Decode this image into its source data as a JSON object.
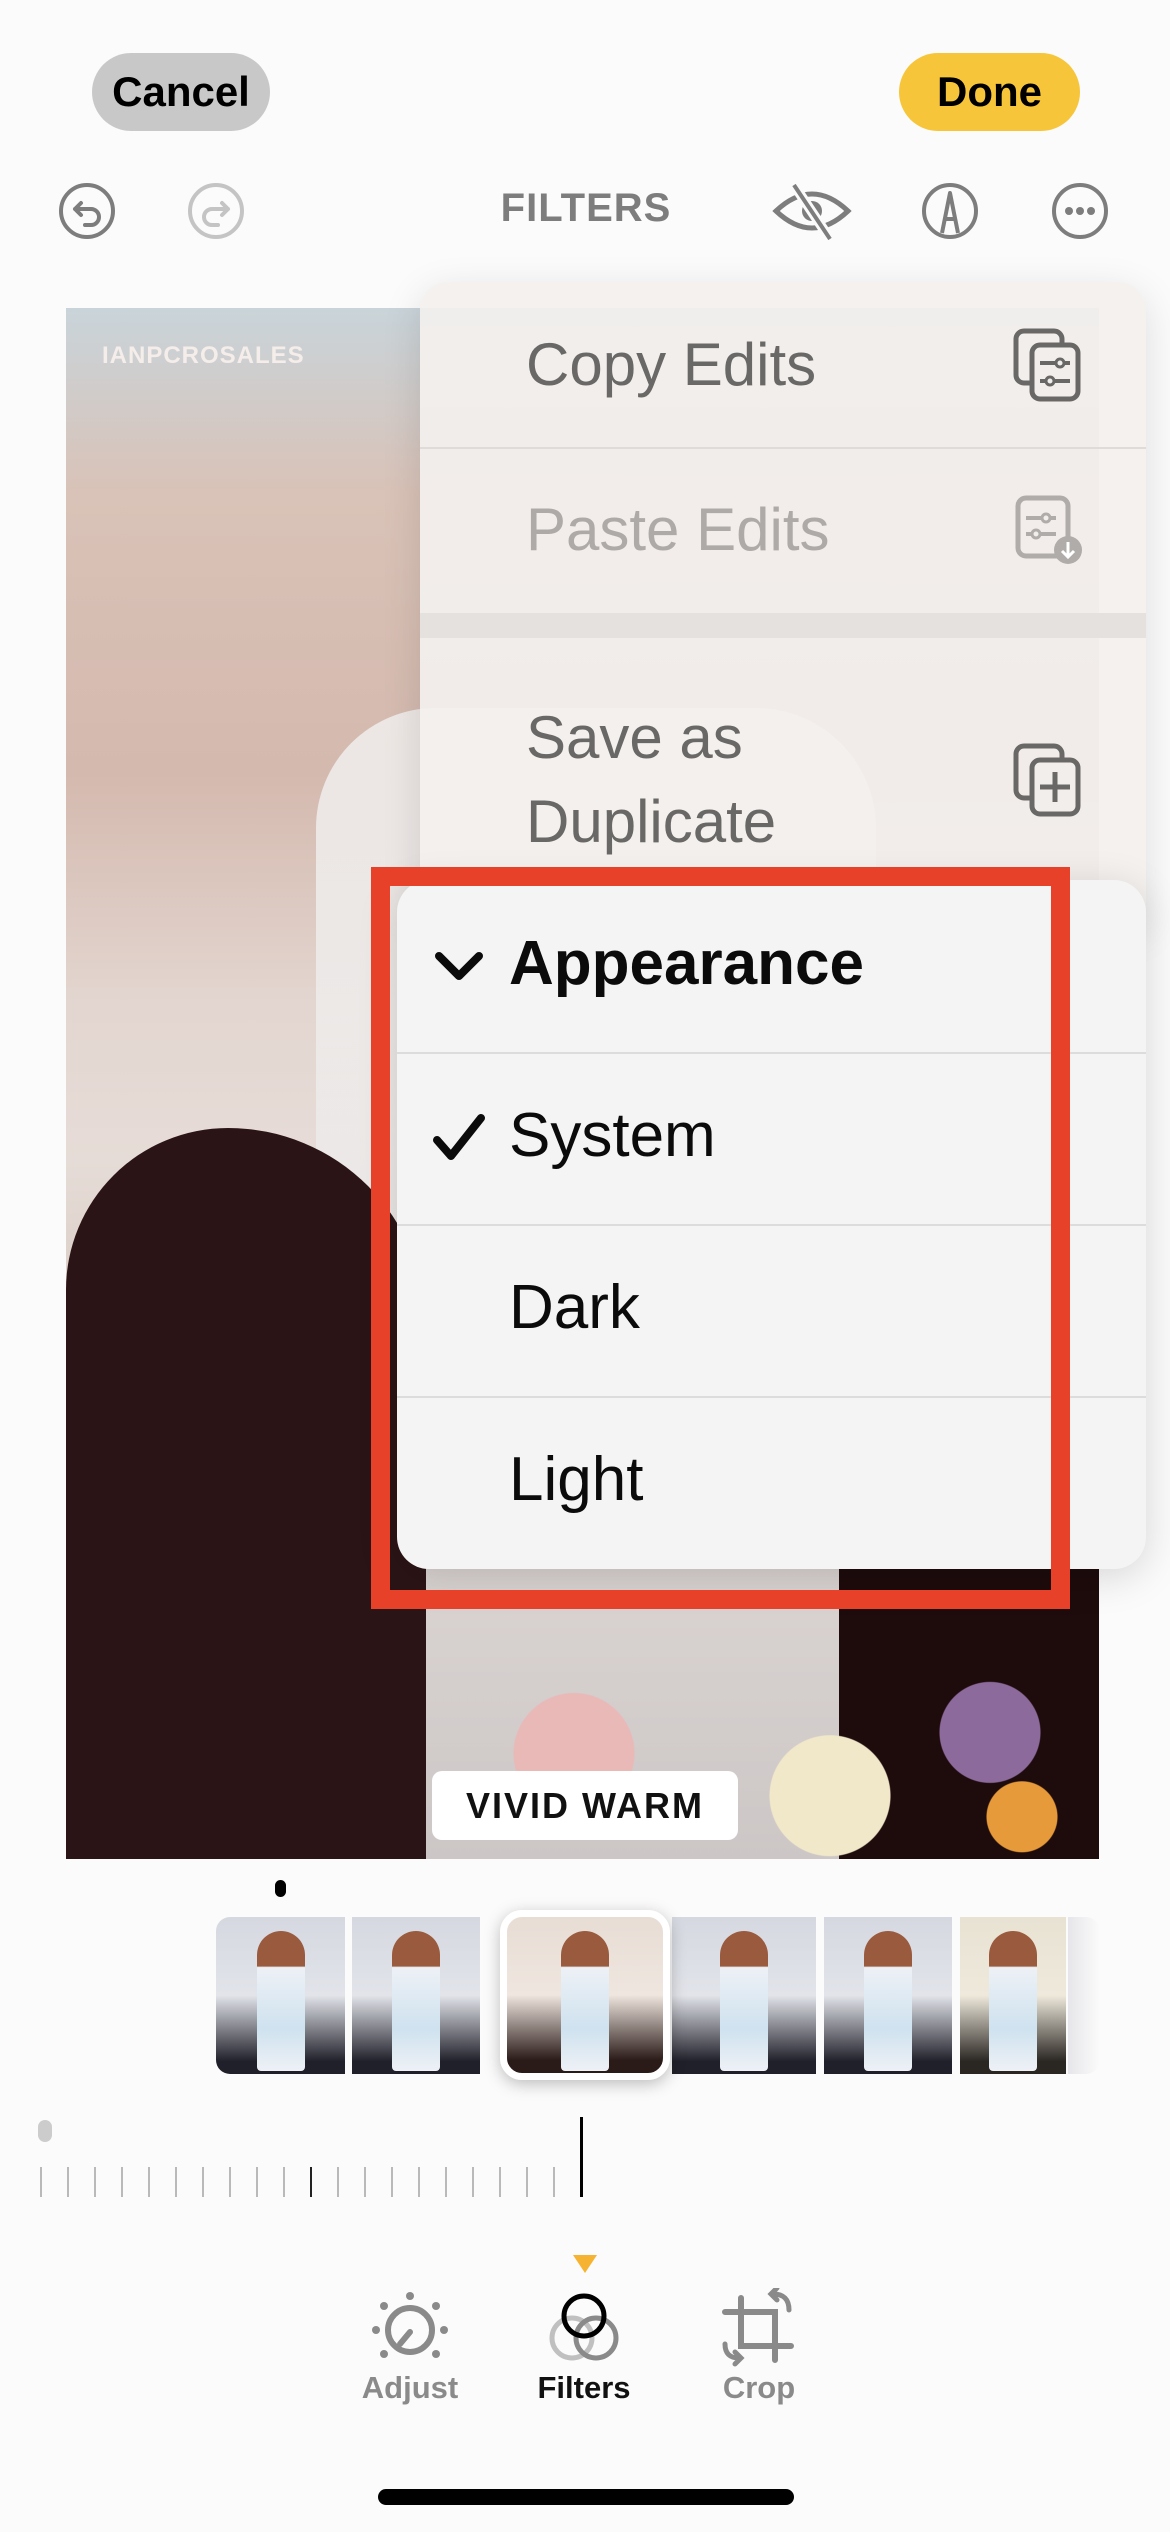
{
  "header": {
    "cancel_label": "Cancel",
    "done_label": "Done",
    "title": "FILTERS"
  },
  "toolbar": {
    "icons": [
      "undo-icon",
      "redo-icon",
      "hide-original-eye-icon",
      "markup-icon",
      "more-icon"
    ]
  },
  "photo": {
    "watermark": "IANPCROSALES",
    "filter_name": "VIVID WARM"
  },
  "menu": {
    "items": [
      {
        "label": "Copy Edits",
        "icon": "copy-edits-icon",
        "enabled": true
      },
      {
        "label": "Paste Edits",
        "icon": "paste-edits-icon",
        "enabled": false
      },
      {
        "label": "Save as Duplicate",
        "icon": "duplicate-icon",
        "enabled": true
      }
    ]
  },
  "appearance_menu": {
    "header": "Appearance",
    "options": [
      {
        "label": "System",
        "selected": true
      },
      {
        "label": "Dark",
        "selected": false
      },
      {
        "label": "Light",
        "selected": false
      }
    ],
    "highlight_color": "#e8412a"
  },
  "filmstrip": {
    "selected_index": 2,
    "thumbnail_count": 7
  },
  "intensity_slider": {
    "value_percent": 100
  },
  "tabs": [
    {
      "label": "Adjust",
      "active": false
    },
    {
      "label": "Filters",
      "active": true
    },
    {
      "label": "Crop",
      "active": false
    }
  ],
  "colors": {
    "accent_yellow": "#f6c53a",
    "tab_indicator": "#f6b331",
    "annotation_red": "#e8412a"
  }
}
